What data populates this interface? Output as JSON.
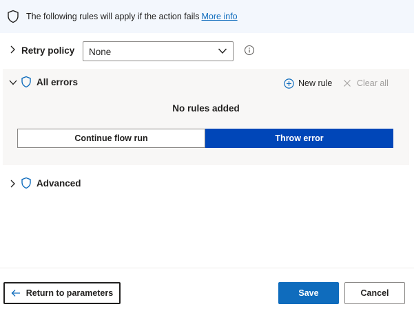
{
  "info_bar": {
    "text": "The following rules will apply if the action fails",
    "link": "More info"
  },
  "retry": {
    "label": "Retry policy",
    "selected": "None"
  },
  "errors": {
    "title": "All errors",
    "new_rule": "New rule",
    "clear_all": "Clear all",
    "empty": "No rules added",
    "options": [
      "Continue flow run",
      "Throw error"
    ],
    "selected_option": "Throw error"
  },
  "advanced": {
    "label": "Advanced"
  },
  "footer": {
    "return": "Return to parameters",
    "save": "Save",
    "cancel": "Cancel"
  },
  "colors": {
    "accent": "#0f6cbd",
    "selected_toggle": "#0046b8",
    "info_bar_bg": "#f3f7fd",
    "panel_bg": "#f8f7f6"
  }
}
